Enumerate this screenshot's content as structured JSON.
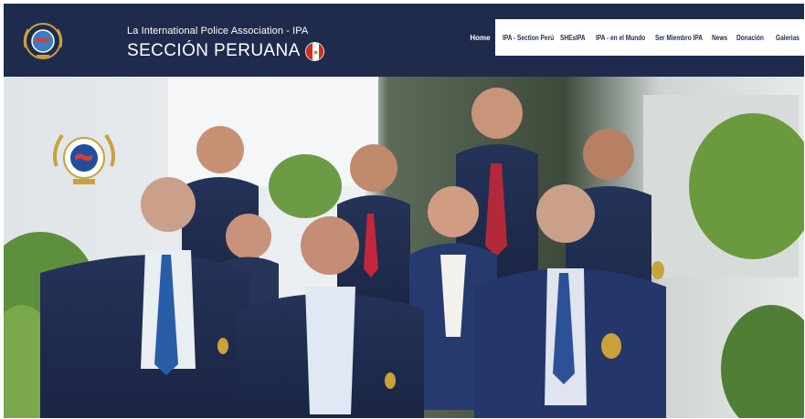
{
  "header": {
    "org_line": "La International Police Association - IPA",
    "section_title": "SECCIÓN PERUANA"
  },
  "nav": {
    "items": [
      {
        "label": "Home"
      },
      {
        "label": "IPA - Section Perú"
      },
      {
        "label": "SHEsIPA"
      },
      {
        "label": "IPA - en el Mundo"
      },
      {
        "label": "Ser Miembro IPA"
      },
      {
        "label": "News"
      },
      {
        "label": "Donación"
      },
      {
        "label": "Galerias"
      }
    ]
  },
  "colors": {
    "header_bg": "#1f2b4d",
    "nav_bg": "#ffffff",
    "nav_text": "#1f2b4d",
    "accent_red": "#d52b1e"
  },
  "icons": {
    "logo": "ipa-globe-laurel-emblem",
    "flag": "peru-flag-circle",
    "hero_badge": "ipa-globe-laurel-emblem"
  }
}
